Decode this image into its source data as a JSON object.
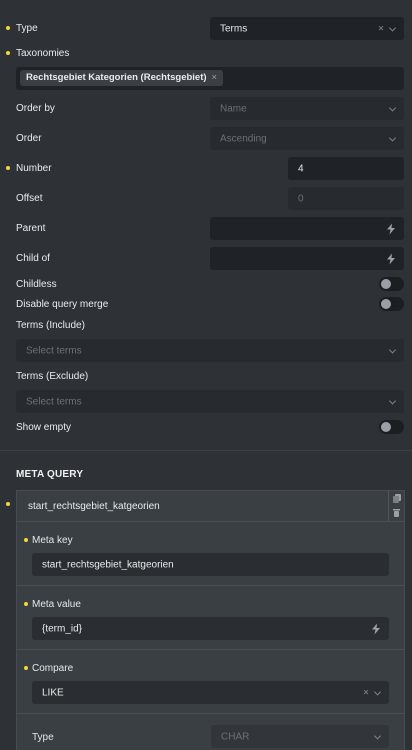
{
  "query": {
    "type": {
      "label": "Type",
      "value": "Terms",
      "clear": "×"
    },
    "taxonomies": {
      "label": "Taxonomies",
      "tag": "Rechtsgebiet Kategorien (Rechtsgebiet)",
      "tag_remove": "×"
    },
    "order_by": {
      "label": "Order by",
      "placeholder": "Name"
    },
    "order": {
      "label": "Order",
      "placeholder": "Ascending"
    },
    "number": {
      "label": "Number",
      "value": "4"
    },
    "offset": {
      "label": "Offset",
      "placeholder": "0"
    },
    "parent": {
      "label": "Parent"
    },
    "child_of": {
      "label": "Child of"
    },
    "childless": {
      "label": "Childless"
    },
    "disable_merge": {
      "label": "Disable query merge"
    },
    "terms_include": {
      "label": "Terms (Include)",
      "placeholder": "Select terms"
    },
    "terms_exclude": {
      "label": "Terms (Exclude)",
      "placeholder": "Select terms"
    },
    "show_empty": {
      "label": "Show empty"
    }
  },
  "meta_query": {
    "title": "META QUERY",
    "item_title": "start_rechtsgebiet_katgeorien",
    "meta_key": {
      "label": "Meta key",
      "value": "start_rechtsgebiet_katgeorien"
    },
    "meta_value": {
      "label": "Meta value",
      "value": "{term_id}"
    },
    "compare": {
      "label": "Compare",
      "value": "LIKE",
      "clear": "×"
    },
    "type": {
      "label": "Type",
      "placeholder": "CHAR"
    }
  },
  "colors": {
    "accent_dot": "#f3d63e",
    "panel_bg": "#2e3237",
    "field_bg": "#1f2226"
  }
}
